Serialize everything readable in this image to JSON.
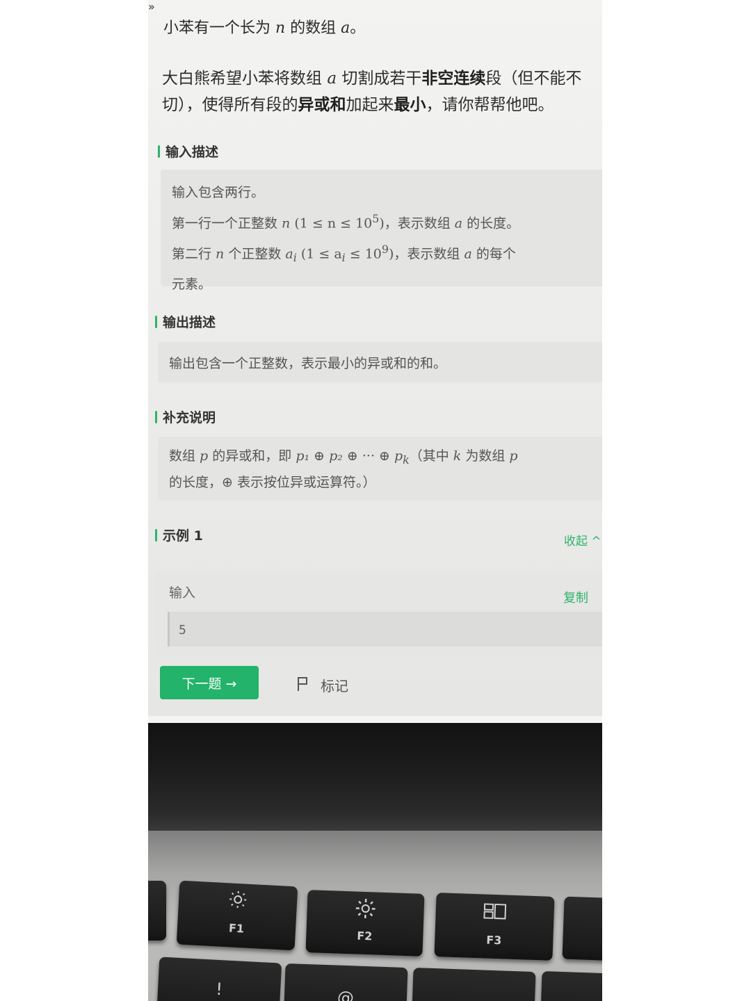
{
  "page": {
    "expand_icon": "»",
    "intro": {
      "pre": "小苯有一个长为 ",
      "var_n": "n",
      "mid": " 的数组 ",
      "var_a": "a",
      "end": "。"
    },
    "desc": {
      "p1": "大白熊希望小苯将数组 ",
      "var_a": "a",
      "p2": " 切割成若干",
      "b1": "非空连续",
      "p3": "段（但不能不切），使得所有段的",
      "b2": "异或和",
      "p4": "加起来",
      "b3": "最小",
      "p5": "，请你帮帮他吧。"
    },
    "input_section": {
      "title": "输入描述",
      "line1": "输入包含两行。",
      "line2": {
        "pre": "第一行一个正整数 ",
        "var": "n",
        "math": " (1 ≤ n ≤ 10",
        "sup": "5",
        "close": ")",
        "post": "，表示数组 ",
        "var_a": "a",
        "end": " 的长度。"
      },
      "line3": {
        "pre": "第二行 ",
        "var": "n",
        "mid": " 个正整数 ",
        "var_ai": "a",
        "sub": "i",
        "math": " (1 ≤ a",
        "sub2": "i",
        "math2": " ≤ 10",
        "sup": "9",
        "close": ")",
        "post": "，表示数组 ",
        "var_a": "a",
        "end": " 的每个"
      },
      "line4": "元素。"
    },
    "output_section": {
      "title": "输出描述",
      "text": "输出包含一个正整数，表示最小的异或和的和。"
    },
    "note_section": {
      "title": "补充说明",
      "l1": {
        "pre": "数组 ",
        "var_p": "p",
        "mid": " 的异或和，即 ",
        "formula": "p₁ ⊕ p₂ ⊕ ··· ⊕ p",
        "sub": "k",
        "post": "（其中 ",
        "var_k": "k",
        "post2": " 为数组 ",
        "var_p2": "p"
      },
      "l2": "的长度，⊕ 表示按位异或运算符。）"
    },
    "example": {
      "title": "示例 1",
      "collapse": "收起 ^",
      "input_label": "输入",
      "copy": "复制",
      "input_value": "5"
    },
    "actions": {
      "next": "下一题 →",
      "mark": "标记"
    }
  },
  "keyboard": {
    "keys": [
      {
        "label": "F1",
        "icon": "brightness-down-icon"
      },
      {
        "label": "F2",
        "icon": "brightness-up-icon"
      },
      {
        "label": "F3",
        "icon": "mission-control-icon"
      }
    ],
    "symbols": {
      "brightness": "☼",
      "mission": "▭▭",
      "exclaim": "!",
      "at": "@"
    }
  },
  "colors": {
    "accent": "#23b36a",
    "section_bar": "#2fb36b"
  }
}
